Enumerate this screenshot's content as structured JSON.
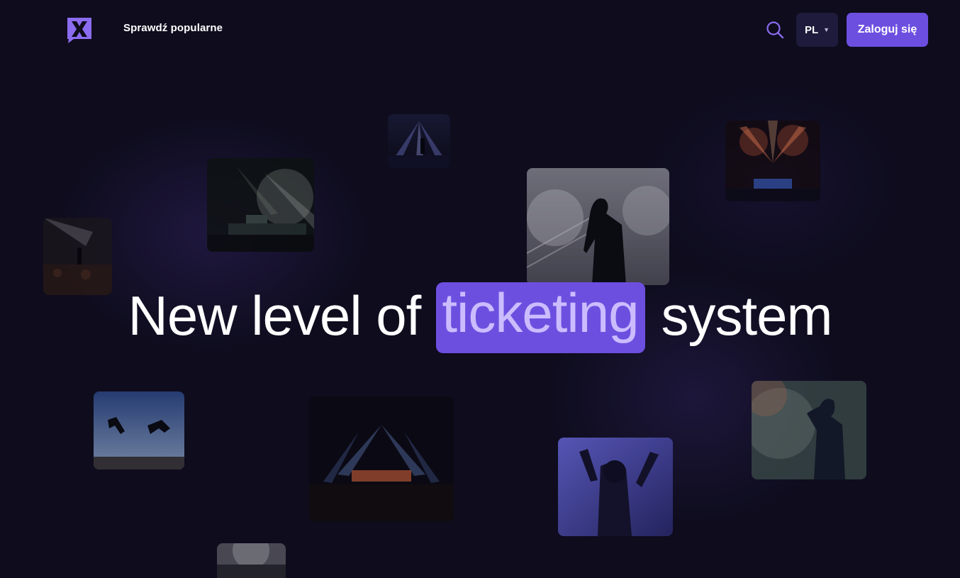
{
  "header": {
    "nav_link": "Sprawdź popularne",
    "language": "PL",
    "login_label": "Zaloguj się"
  },
  "hero": {
    "headline_before": "New level of",
    "headline_highlight": "ticketing",
    "headline_after": "system"
  },
  "colors": {
    "background": "#0e0c1d",
    "accent": "#6d4fe0",
    "highlight_text": "#cbbcff",
    "lang_button": "#1e1b3c"
  },
  "icons": {
    "logo": "x-logo-icon",
    "search": "search-icon",
    "language_caret": "caret-down-icon"
  }
}
